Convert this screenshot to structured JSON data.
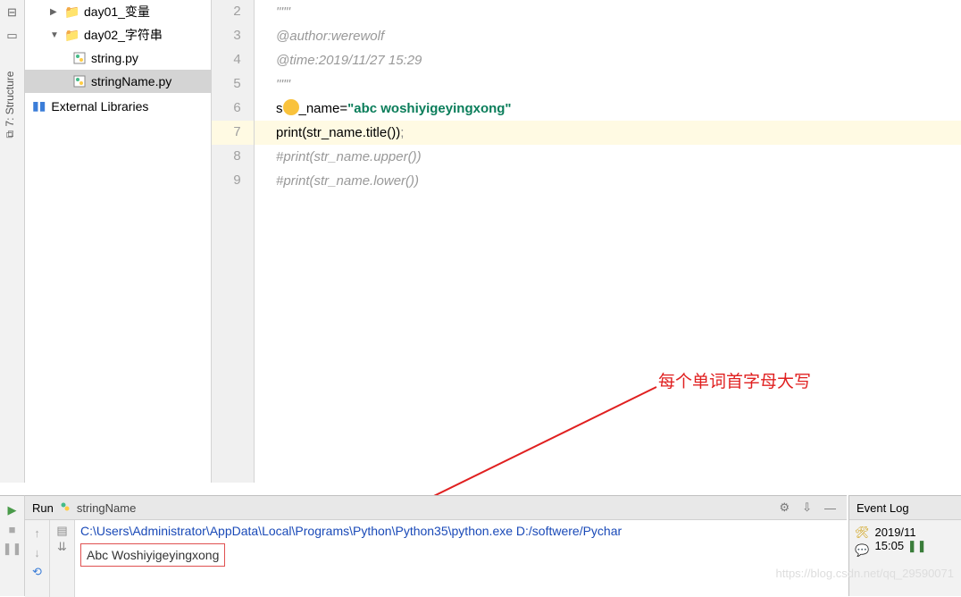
{
  "sidebar": {
    "structure_tab": "7: Structure",
    "tree": {
      "items": [
        {
          "label": "day01_变量"
        },
        {
          "label": "day02_字符串"
        },
        {
          "label": "string.py"
        },
        {
          "label": "stringName.py"
        }
      ],
      "ext_lib": "External Libraries"
    }
  },
  "editor": {
    "lines": [
      {
        "n": "2",
        "comment": "\"\"\""
      },
      {
        "n": "3",
        "comment": "@author:werewolf"
      },
      {
        "n": "4",
        "comment": "@time:2019/11/27 15:29"
      },
      {
        "n": "5",
        "comment": "\"\"\""
      },
      {
        "n": "6",
        "pre": "s",
        "post": "_name=",
        "str": "\"abc woshiyigeyingxong\""
      },
      {
        "n": "7",
        "print_pre": "print",
        "print_mid": "(str_name.",
        "print_fn": "title",
        "print_post": "())",
        "semi": ";"
      },
      {
        "n": "8",
        "comment": "#print(str_name.upper())"
      },
      {
        "n": "9",
        "comment": "#print(str_name.lower())"
      }
    ]
  },
  "run": {
    "label": "Run",
    "title": "stringName",
    "cmd": "C:\\Users\\Administrator\\AppData\\Local\\Programs\\Python\\Python35\\python.exe D:/softwere/Pychar",
    "output": "Abc Woshiyigeyingxong"
  },
  "event_log": {
    "title": "Event Log",
    "date": "2019/11",
    "time": "15:05"
  },
  "annotation": "每个单词首字母大写",
  "watermark": "https://blog.csdn.net/qq_29590071"
}
